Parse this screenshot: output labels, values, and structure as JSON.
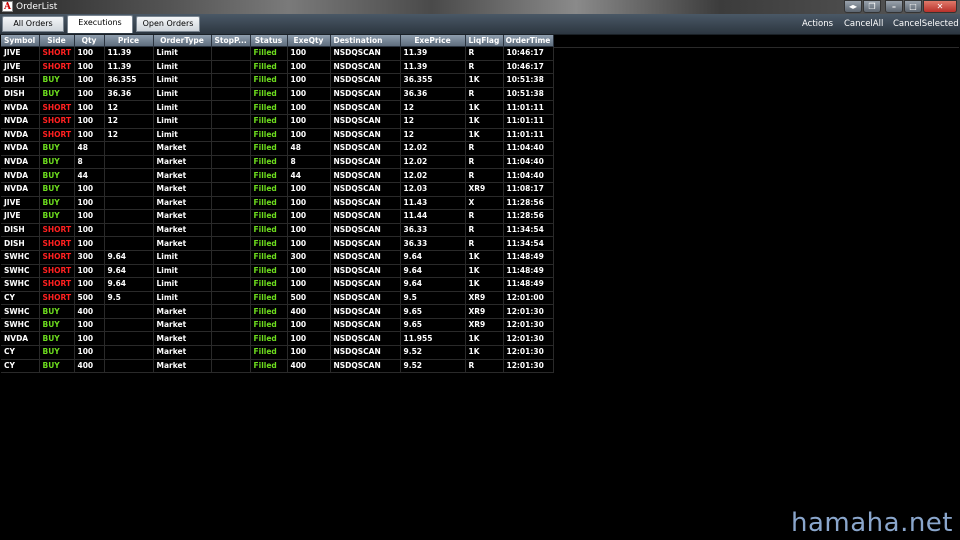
{
  "window": {
    "title": "OrderList",
    "app_icon_letter": "A"
  },
  "window_controls": [
    "◂▸",
    "❐",
    "–",
    "□",
    "✕"
  ],
  "tabs": [
    {
      "label": "All Orders",
      "active": false
    },
    {
      "label": "Executions",
      "active": true
    },
    {
      "label": "Open Orders",
      "active": false
    }
  ],
  "actions": [
    "Actions",
    "CancelAll",
    "CancelSelected"
  ],
  "columns": [
    "Symbol",
    "Side",
    "Qty",
    "Price",
    "OrderType",
    "StopP...",
    "Status",
    "ExeQty",
    "Destination",
    "ExePrice",
    "LiqFlag",
    "OrderTime"
  ],
  "colors": {
    "short": "#ff2020",
    "buy": "#6ddc1e",
    "filled": "#6ddc1e",
    "text": "#ffffff",
    "background": "#000000",
    "header": "#7a8a9a"
  },
  "rows": [
    [
      "JIVE",
      "SHORT",
      "100",
      "11.39",
      "Limit",
      "",
      "Filled",
      "100",
      "NSDQSCAN",
      "11.39",
      "R",
      "10:46:17"
    ],
    [
      "JIVE",
      "SHORT",
      "100",
      "11.39",
      "Limit",
      "",
      "Filled",
      "100",
      "NSDQSCAN",
      "11.39",
      "R",
      "10:46:17"
    ],
    [
      "DISH",
      "BUY",
      "100",
      "36.355",
      "Limit",
      "",
      "Filled",
      "100",
      "NSDQSCAN",
      "36.355",
      "1K",
      "10:51:38"
    ],
    [
      "DISH",
      "BUY",
      "100",
      "36.36",
      "Limit",
      "",
      "Filled",
      "100",
      "NSDQSCAN",
      "36.36",
      "R",
      "10:51:38"
    ],
    [
      "NVDA",
      "SHORT",
      "100",
      "12",
      "Limit",
      "",
      "Filled",
      "100",
      "NSDQSCAN",
      "12",
      "1K",
      "11:01:11"
    ],
    [
      "NVDA",
      "SHORT",
      "100",
      "12",
      "Limit",
      "",
      "Filled",
      "100",
      "NSDQSCAN",
      "12",
      "1K",
      "11:01:11"
    ],
    [
      "NVDA",
      "SHORT",
      "100",
      "12",
      "Limit",
      "",
      "Filled",
      "100",
      "NSDQSCAN",
      "12",
      "1K",
      "11:01:11"
    ],
    [
      "NVDA",
      "BUY",
      "48",
      "",
      "Market",
      "",
      "Filled",
      "48",
      "NSDQSCAN",
      "12.02",
      "R",
      "11:04:40"
    ],
    [
      "NVDA",
      "BUY",
      "8",
      "",
      "Market",
      "",
      "Filled",
      "8",
      "NSDQSCAN",
      "12.02",
      "R",
      "11:04:40"
    ],
    [
      "NVDA",
      "BUY",
      "44",
      "",
      "Market",
      "",
      "Filled",
      "44",
      "NSDQSCAN",
      "12.02",
      "R",
      "11:04:40"
    ],
    [
      "NVDA",
      "BUY",
      "100",
      "",
      "Market",
      "",
      "Filled",
      "100",
      "NSDQSCAN",
      "12.03",
      "XR9",
      "11:08:17"
    ],
    [
      "JIVE",
      "BUY",
      "100",
      "",
      "Market",
      "",
      "Filled",
      "100",
      "NSDQSCAN",
      "11.43",
      "X",
      "11:28:56"
    ],
    [
      "JIVE",
      "BUY",
      "100",
      "",
      "Market",
      "",
      "Filled",
      "100",
      "NSDQSCAN",
      "11.44",
      "R",
      "11:28:56"
    ],
    [
      "DISH",
      "SHORT",
      "100",
      "",
      "Market",
      "",
      "Filled",
      "100",
      "NSDQSCAN",
      "36.33",
      "R",
      "11:34:54"
    ],
    [
      "DISH",
      "SHORT",
      "100",
      "",
      "Market",
      "",
      "Filled",
      "100",
      "NSDQSCAN",
      "36.33",
      "R",
      "11:34:54"
    ],
    [
      "SWHC",
      "SHORT",
      "300",
      "9.64",
      "Limit",
      "",
      "Filled",
      "300",
      "NSDQSCAN",
      "9.64",
      "1K",
      "11:48:49"
    ],
    [
      "SWHC",
      "SHORT",
      "100",
      "9.64",
      "Limit",
      "",
      "Filled",
      "100",
      "NSDQSCAN",
      "9.64",
      "1K",
      "11:48:49"
    ],
    [
      "SWHC",
      "SHORT",
      "100",
      "9.64",
      "Limit",
      "",
      "Filled",
      "100",
      "NSDQSCAN",
      "9.64",
      "1K",
      "11:48:49"
    ],
    [
      "CY",
      "SHORT",
      "500",
      "9.5",
      "Limit",
      "",
      "Filled",
      "500",
      "NSDQSCAN",
      "9.5",
      "XR9",
      "12:01:00"
    ],
    [
      "SWHC",
      "BUY",
      "400",
      "",
      "Market",
      "",
      "Filled",
      "400",
      "NSDQSCAN",
      "9.65",
      "XR9",
      "12:01:30"
    ],
    [
      "SWHC",
      "BUY",
      "100",
      "",
      "Market",
      "",
      "Filled",
      "100",
      "NSDQSCAN",
      "9.65",
      "XR9",
      "12:01:30"
    ],
    [
      "NVDA",
      "BUY",
      "100",
      "",
      "Market",
      "",
      "Filled",
      "100",
      "NSDQSCAN",
      "11.955",
      "1K",
      "12:01:30"
    ],
    [
      "CY",
      "BUY",
      "100",
      "",
      "Market",
      "",
      "Filled",
      "100",
      "NSDQSCAN",
      "9.52",
      "1K",
      "12:01:30"
    ],
    [
      "CY",
      "BUY",
      "400",
      "",
      "Market",
      "",
      "Filled",
      "400",
      "NSDQSCAN",
      "9.52",
      "R",
      "12:01:30"
    ]
  ],
  "watermark": "hamaha.net"
}
